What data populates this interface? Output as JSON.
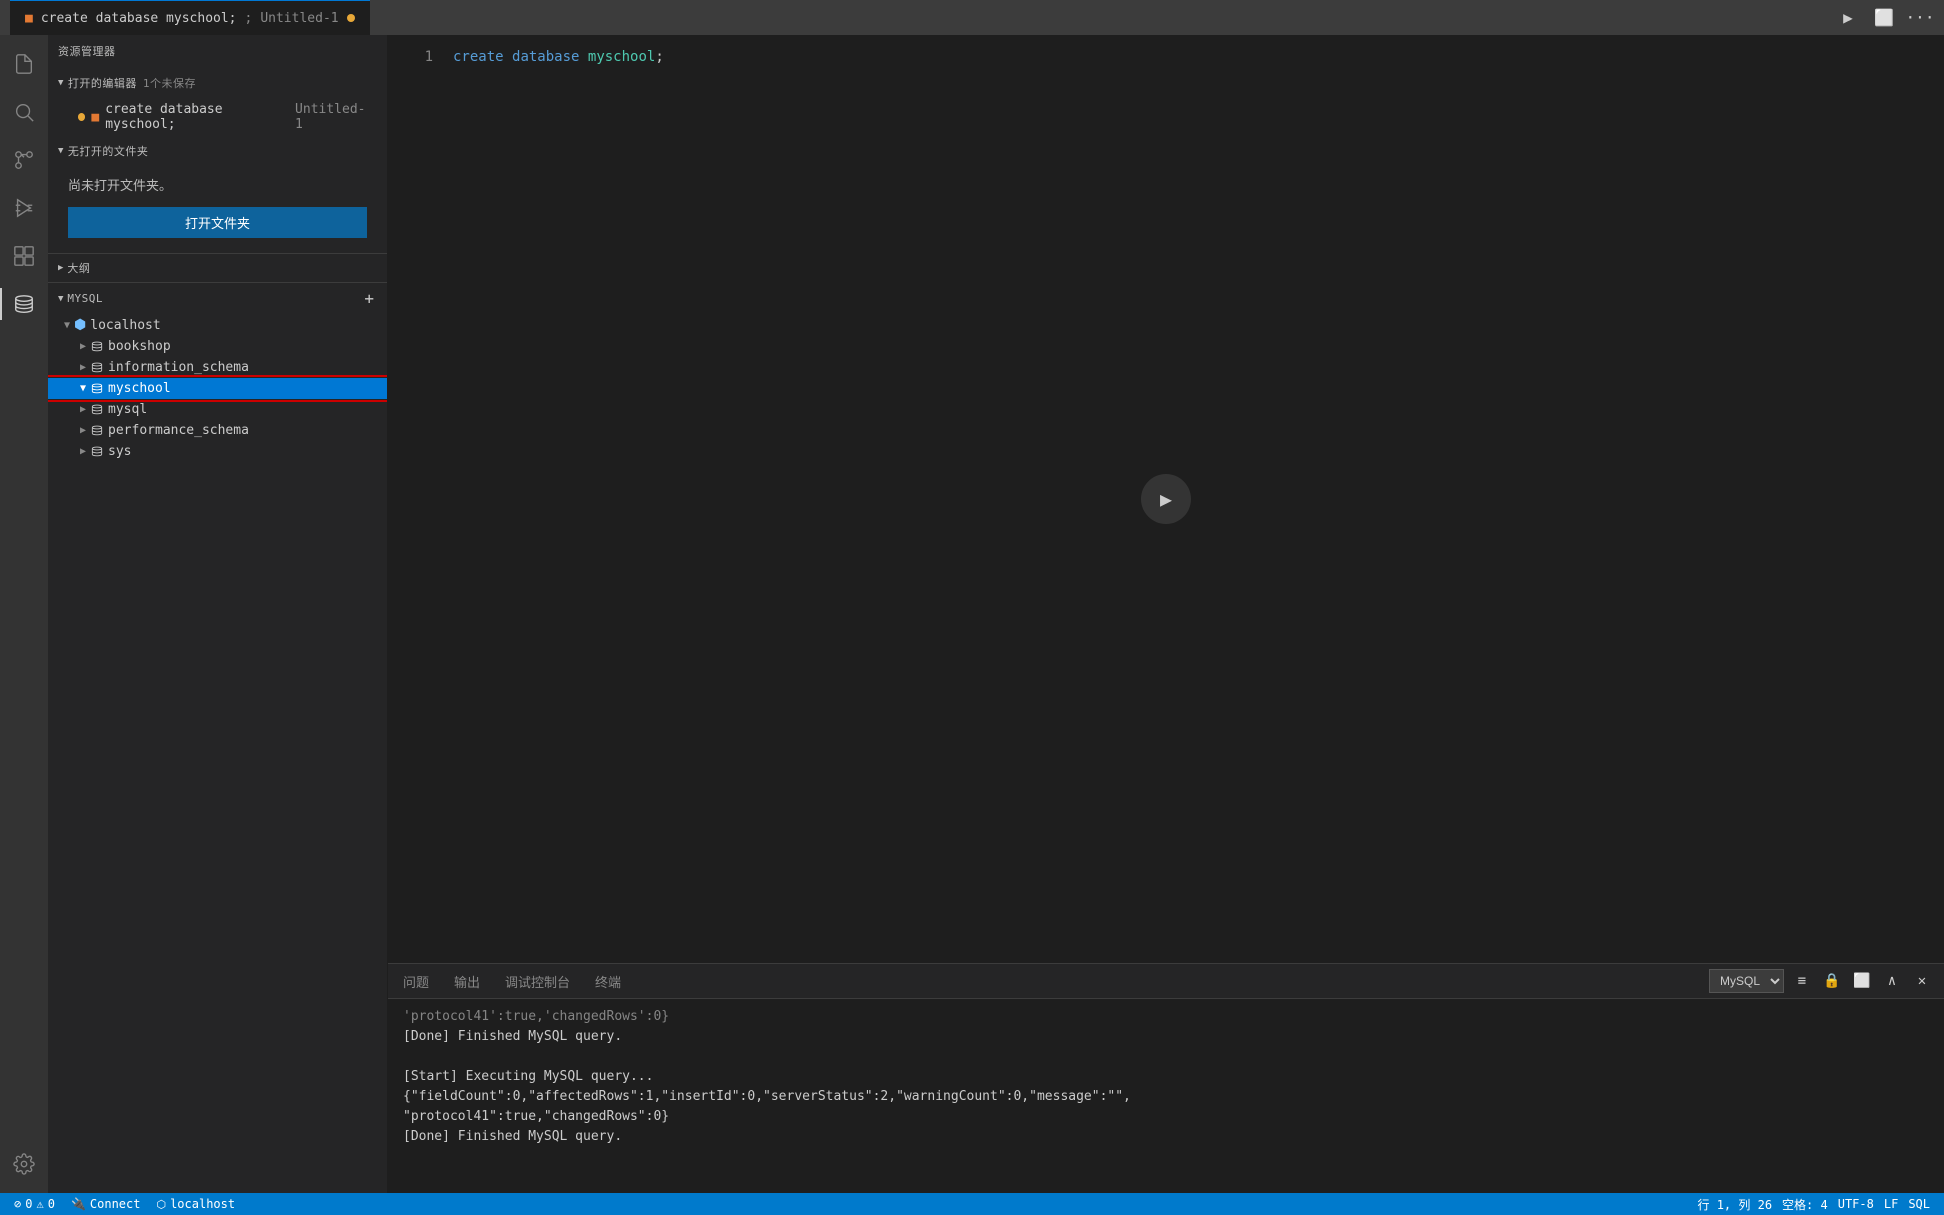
{
  "titleBar": {
    "tab1": {
      "label": "create database myschool;",
      "separator": ";",
      "tab2": "Untitled-1",
      "isDirty": true
    }
  },
  "activityBar": {
    "icons": [
      {
        "name": "file-icon",
        "symbol": "⎘",
        "active": false
      },
      {
        "name": "search-icon",
        "symbol": "🔍",
        "active": false
      },
      {
        "name": "source-control-icon",
        "symbol": "⑂",
        "active": false
      },
      {
        "name": "debug-icon",
        "symbol": "▷",
        "active": false
      },
      {
        "name": "extensions-icon",
        "symbol": "⊞",
        "active": false
      },
      {
        "name": "database-icon",
        "symbol": "🗄",
        "active": true
      }
    ],
    "bottomIcons": [
      {
        "name": "settings-icon",
        "symbol": "⚙",
        "active": false
      }
    ]
  },
  "sidebar": {
    "sections": {
      "fileExplorer": {
        "header": "资源管理器",
        "openEditors": {
          "label": "打开的编辑器",
          "badge": "1个未保存",
          "files": [
            {
              "name": "create database myschool;",
              "secondary": "Untitled-1",
              "dirty": true
            }
          ]
        },
        "noFolderSection": {
          "label": "无打开的文件夹",
          "noOpenText": "尚未打开文件夹。",
          "openFolderBtn": "打开文件夹"
        }
      },
      "outline": {
        "label": "大纲"
      },
      "mysql": {
        "label": "MYSQL",
        "addBtn": "+",
        "tree": {
          "localhost": {
            "label": "localhost",
            "expanded": true,
            "children": {
              "bookshop": {
                "label": "bookshop",
                "expanded": false
              },
              "information_schema": {
                "label": "information_schema",
                "expanded": false
              },
              "myschool": {
                "label": "myschool",
                "expanded": true,
                "selected": true
              },
              "mysql": {
                "label": "mysql",
                "expanded": false
              },
              "performance_schema": {
                "label": "performance_schema",
                "expanded": false
              },
              "sys": {
                "label": "sys",
                "expanded": false
              }
            }
          }
        }
      }
    }
  },
  "editor": {
    "lines": [
      {
        "number": "1",
        "tokens": [
          {
            "text": "create",
            "class": "kw-create"
          },
          {
            "text": " "
          },
          {
            "text": "database",
            "class": "kw-database"
          },
          {
            "text": " "
          },
          {
            "text": "myschool",
            "class": "db-name"
          },
          {
            "text": ";",
            "class": "kw-semi"
          }
        ]
      }
    ]
  },
  "terminal": {
    "tabs": [
      {
        "label": "问题",
        "active": false
      },
      {
        "label": "输出",
        "active": false
      },
      {
        "label": "调试控制台",
        "active": false
      },
      {
        "label": "终端",
        "active": false
      }
    ],
    "selectValue": "MySQL",
    "outputLines": [
      {
        "text": "'protocol41':true,'changedRows':0}",
        "faded": true
      },
      {
        "text": "[Done] Finished MySQL query."
      },
      {
        "text": ""
      },
      {
        "text": "[Start] Executing MySQL query..."
      },
      {
        "text": "{\"fieldCount\":0,\"affectedRows\":1,\"insertId\":0,\"serverStatus\":2,\"warningCount\":0,\"message\":\"\","
      },
      {
        "text": "\"protocol41\":true,\"changedRows\":0}"
      },
      {
        "text": "[Done] Finished MySQL query."
      }
    ]
  },
  "statusBar": {
    "leftItems": [
      {
        "label": "⓪ 0",
        "icon": "error-icon"
      },
      {
        "label": "⚠ 0",
        "icon": "warning-icon"
      },
      {
        "label": "Connect",
        "icon": "plug-icon"
      },
      {
        "label": "localhost",
        "icon": "server-icon"
      }
    ],
    "rightItems": [
      {
        "label": "行 1, 列 26"
      },
      {
        "label": "空格: 4"
      },
      {
        "label": "UTF-8"
      },
      {
        "label": "LF"
      },
      {
        "label": "SQL"
      }
    ]
  }
}
